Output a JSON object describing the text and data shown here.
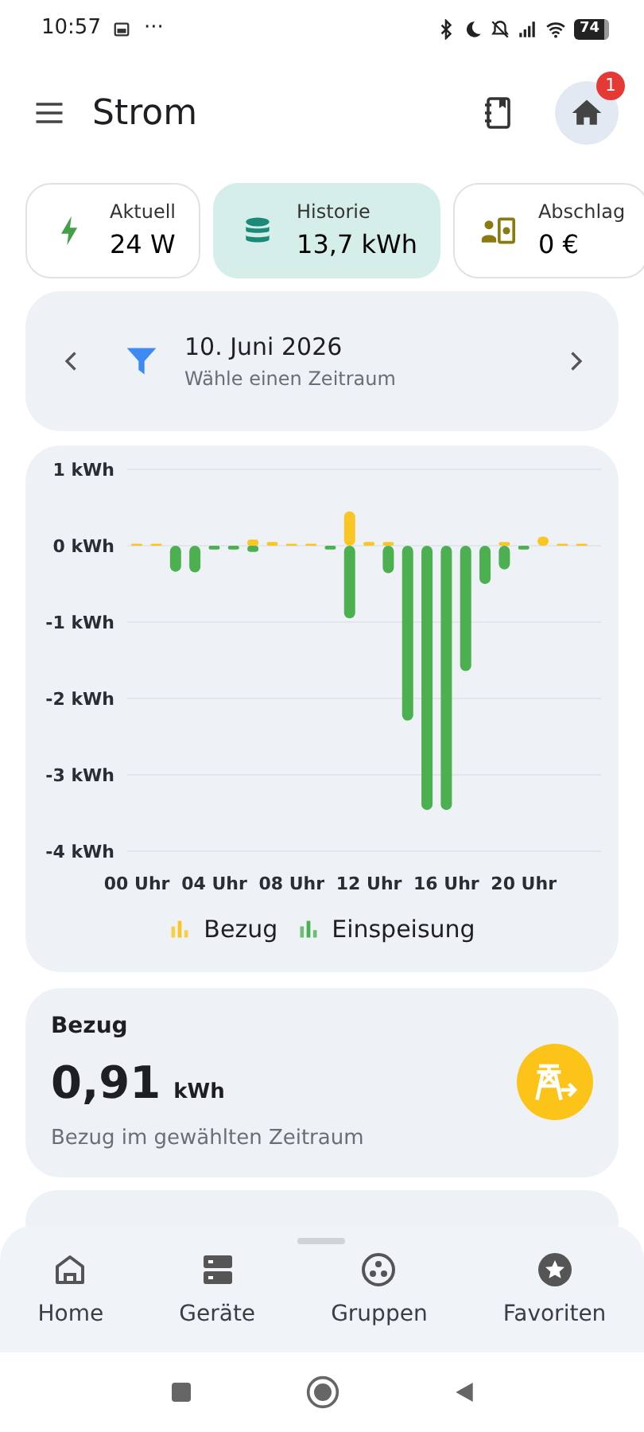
{
  "status_bar": {
    "time": "10:57",
    "more": "···",
    "battery": "74"
  },
  "app_bar": {
    "title": "Strom",
    "notification_count": "1"
  },
  "summary_tiles": [
    {
      "kind": "power",
      "label": "Aktuell",
      "value": "24 W",
      "selected": false
    },
    {
      "kind": "history",
      "label": "Historie",
      "value": "13,7 kWh",
      "selected": true
    },
    {
      "kind": "payment",
      "label": "Abschlag",
      "value": "0 €",
      "selected": false
    }
  ],
  "period": {
    "date": "10. Juni 2026",
    "hint": "Wähle einen Zeitraum"
  },
  "chart": {
    "chart_data": {
      "type": "bar",
      "stacked": true,
      "x": [
        0,
        1,
        2,
        3,
        4,
        5,
        6,
        7,
        8,
        9,
        10,
        11,
        12,
        13,
        14,
        15,
        16,
        17,
        18,
        19,
        20,
        21,
        22,
        23
      ],
      "series": [
        {
          "name": "Bezug",
          "color": "#f9c623",
          "values": [
            0,
            0,
            0,
            0,
            0,
            0,
            0.08,
            0.05,
            0,
            0,
            0,
            0.45,
            0.05,
            0.05,
            0,
            0,
            0,
            0,
            0,
            0.05,
            0,
            0.12,
            0,
            0
          ]
        },
        {
          "name": "Einspeisung",
          "color": "#4caf50",
          "values": [
            0,
            0,
            -0.34,
            -0.35,
            -0.05,
            -0.05,
            -0.08,
            0,
            0,
            0,
            -0.05,
            -0.95,
            0,
            -0.36,
            -2.29,
            -3.46,
            -3.46,
            -1.64,
            -0.5,
            -0.31,
            -0.05,
            0,
            0,
            0
          ]
        }
      ],
      "xlim": [
        -0.5,
        24
      ],
      "ylim": [
        -4,
        1
      ],
      "grid": true,
      "legend": true,
      "yticks": [
        {
          "value": 1,
          "label": "1 kWh"
        },
        {
          "value": 0,
          "label": "0 kWh"
        },
        {
          "value": -1,
          "label": "-1 kWh"
        },
        {
          "value": -2,
          "label": "-2 kWh"
        },
        {
          "value": -3,
          "label": "-3 kWh"
        },
        {
          "value": -4,
          "label": "-4 kWh"
        }
      ],
      "xticks": [
        {
          "value": 0,
          "label": "00 Uhr"
        },
        {
          "value": 4,
          "label": "04 Uhr"
        },
        {
          "value": 8,
          "label": "08 Uhr"
        },
        {
          "value": 12,
          "label": "12 Uhr"
        },
        {
          "value": 16,
          "label": "16 Uhr"
        },
        {
          "value": 20,
          "label": "20 Uhr"
        }
      ]
    }
  },
  "stat_cards": [
    {
      "kind": "import",
      "title": "Bezug",
      "value": "0,91",
      "unit": "kWh",
      "caption": "Bezug im gewählten Zeitraum"
    },
    {
      "kind": "export"
    }
  ],
  "bottom_nav": [
    {
      "kind": "home",
      "label": "Home",
      "selected": false
    },
    {
      "kind": "devices",
      "label": "Geräte",
      "selected": false
    },
    {
      "kind": "groups",
      "label": "Gruppen",
      "selected": false
    },
    {
      "kind": "favorites",
      "label": "Favoriten",
      "selected": false
    }
  ]
}
